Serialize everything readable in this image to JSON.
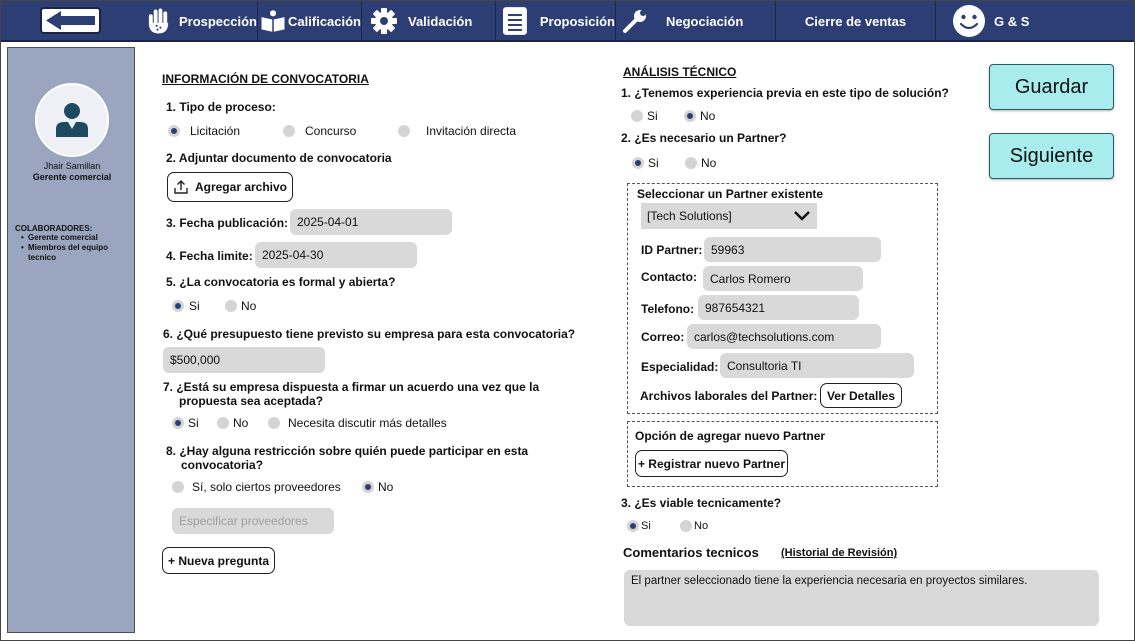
{
  "nav": {
    "items": [
      {
        "label": "Prospección",
        "icon": "hand-icon"
      },
      {
        "label": "Calificación",
        "icon": "reader-icon"
      },
      {
        "label": "Validación",
        "icon": "gear-icon"
      },
      {
        "label": "Proposición",
        "icon": "document-icon"
      },
      {
        "label": "Negociación",
        "icon": "wrench-icon"
      },
      {
        "label": "Cierre de ventas",
        "icon": ""
      },
      {
        "label": "G & S",
        "icon": "smiley-icon"
      }
    ]
  },
  "sidebar": {
    "user_name": "Jhair Samillan",
    "user_role": "Gerente comercial",
    "collaborators_title": "COLABORADORES:",
    "collaborators": [
      "Gerente comercial",
      "Miembros del equipo tecnico"
    ]
  },
  "convocatoria": {
    "title": "INFORMACIÓN DE CONVOCATORIA",
    "q1": "1. Tipo de proceso:",
    "q1_options": [
      "Licitación",
      "Concurso",
      "Invitación directa"
    ],
    "q2": "2. Adjuntar documento de convocatoria",
    "attach_button": "Agregar archivo",
    "q3": "3. Fecha publicación:",
    "pub_date": "2025-04-01",
    "q4": "4. Fecha limite:",
    "deadline": "2025-04-30",
    "q5": "5. ¿La convocatoria es formal y abierta?",
    "q5_options": [
      "Si",
      "No"
    ],
    "q6": "6. ¿Qué presupuesto tiene previsto su empresa para esta convocatoria?",
    "budget": "$500,000",
    "q7_line1": "7. ¿Está su empresa dispuesta a firmar un acuerdo una vez que la",
    "q7_line2": "propuesta sea aceptada?",
    "q7_options": [
      "Si",
      "No",
      "Necesita discutir más detalles"
    ],
    "q8_line1": "8. ¿Hay alguna restricción sobre quién puede participar en esta",
    "q8_line2": "convocatoria?",
    "q8_options": [
      "Sí, solo ciertos proveedores",
      "No"
    ],
    "providers_placeholder": "Especificar proveedores",
    "new_question_button": "+ Nueva pregunta"
  },
  "tecnico": {
    "title": "ANÁLISIS TÉCNICO",
    "q1": "1. ¿Tenemos experiencia previa en este tipo de solución?",
    "q1_options": [
      "Si",
      "No"
    ],
    "q2": "2. ¿Es necesario un Partner?",
    "q2_options": [
      "Si",
      "No"
    ],
    "partner_box_title": "Seleccionar un Partner existente",
    "partner_select": "[Tech Solutions]",
    "id_label": "ID Partner:",
    "id_value": "59963",
    "contact_label": "Contacto:",
    "contact_value": "Carlos Romero",
    "phone_label": "Telefono:",
    "phone_value": "987654321",
    "email_label": "Correo:",
    "email_value": "carlos@techsolutions.com",
    "specialty_label": "Especialidad:",
    "specialty_value": "Consultoria TI",
    "files_label": "Archivos laborales del Partner:",
    "details_button": "Ver Detalles",
    "new_partner_title": "Opción de agregar nuevo Partner",
    "register_button": "+ Registrar nuevo Partner",
    "q3": "3. ¿Es viable tecnicamente?",
    "q3_options": [
      "Si",
      "No"
    ],
    "comments_title": "Comentarios tecnicos",
    "history_link": "(Historial de Revisión)",
    "comments_text": "El partner seleccionado tiene la experiencia necesaria en proyectos similares."
  },
  "actions": {
    "save": "Guardar",
    "next": "Siguiente"
  }
}
